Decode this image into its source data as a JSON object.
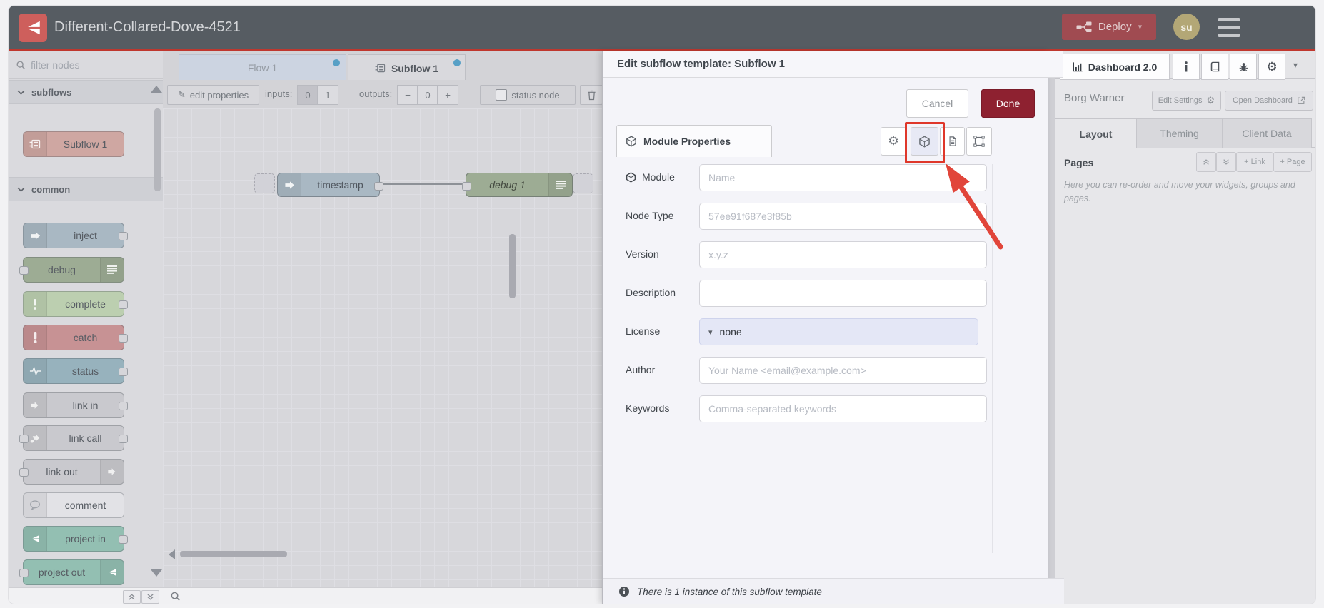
{
  "header": {
    "title": "Different-Collared-Dove-4521",
    "deploy": {
      "label": "Deploy"
    },
    "avatar": {
      "initials": "su"
    }
  },
  "palette": {
    "filter_placeholder": "filter nodes",
    "categories": [
      {
        "label": "subflows",
        "nodes": [
          {
            "label": "Subflow 1"
          }
        ]
      },
      {
        "label": "common",
        "nodes": [
          {
            "label": "inject"
          },
          {
            "label": "debug"
          },
          {
            "label": "complete"
          },
          {
            "label": "catch"
          },
          {
            "label": "status"
          },
          {
            "label": "link in"
          },
          {
            "label": "link call"
          },
          {
            "label": "link out"
          },
          {
            "label": "comment"
          },
          {
            "label": "project in"
          },
          {
            "label": "project out"
          }
        ]
      }
    ]
  },
  "workspace": {
    "tabs": [
      {
        "label": "Flow 1"
      },
      {
        "label": "Subflow 1"
      }
    ],
    "toolbar": {
      "edit_properties": "edit properties",
      "inputs_label": "inputs:",
      "input_zero": "0",
      "input_one": "1",
      "outputs_label": "outputs:",
      "minus": "−",
      "output_count": "0",
      "plus": "+",
      "status_node": "status node"
    },
    "canvas": {
      "nodes": [
        {
          "label": "timestamp"
        },
        {
          "label": "debug 1"
        }
      ]
    }
  },
  "tray": {
    "title": "Edit subflow template: Subflow 1",
    "cancel": "Cancel",
    "done": "Done",
    "tab_label": "Module Properties",
    "fields": {
      "module": {
        "label": "Module",
        "placeholder": "Name"
      },
      "node_type": {
        "label": "Node Type",
        "placeholder": "57ee91f687e3f85b"
      },
      "version": {
        "label": "Version",
        "placeholder": "x.y.z"
      },
      "description": {
        "label": "Description"
      },
      "license": {
        "label": "License",
        "value": "none"
      },
      "author": {
        "label": "Author",
        "placeholder": "Your Name <email@example.com>"
      },
      "keywords": {
        "label": "Keywords",
        "placeholder": "Comma-separated keywords"
      }
    },
    "footer": "There is 1 instance of this subflow template"
  },
  "sidebar": {
    "main_tab": "Dashboard 2.0",
    "board_name": "Borg Warner",
    "edit_settings": "Edit Settings",
    "open_dashboard": "Open Dashboard",
    "tabs": [
      {
        "label": "Layout"
      },
      {
        "label": "Theming"
      },
      {
        "label": "Client Data"
      }
    ],
    "pages": {
      "title": "Pages",
      "link_button": "+ Link",
      "page_button": "+ Page",
      "help": "Here you can re-order and move your widgets, groups and pages."
    }
  },
  "colors": {
    "annotation_red": "#df372a",
    "deploy_red": "#a04b51",
    "done_red": "#8e2130",
    "unsaved_dot_blue": "#57a0c6"
  }
}
